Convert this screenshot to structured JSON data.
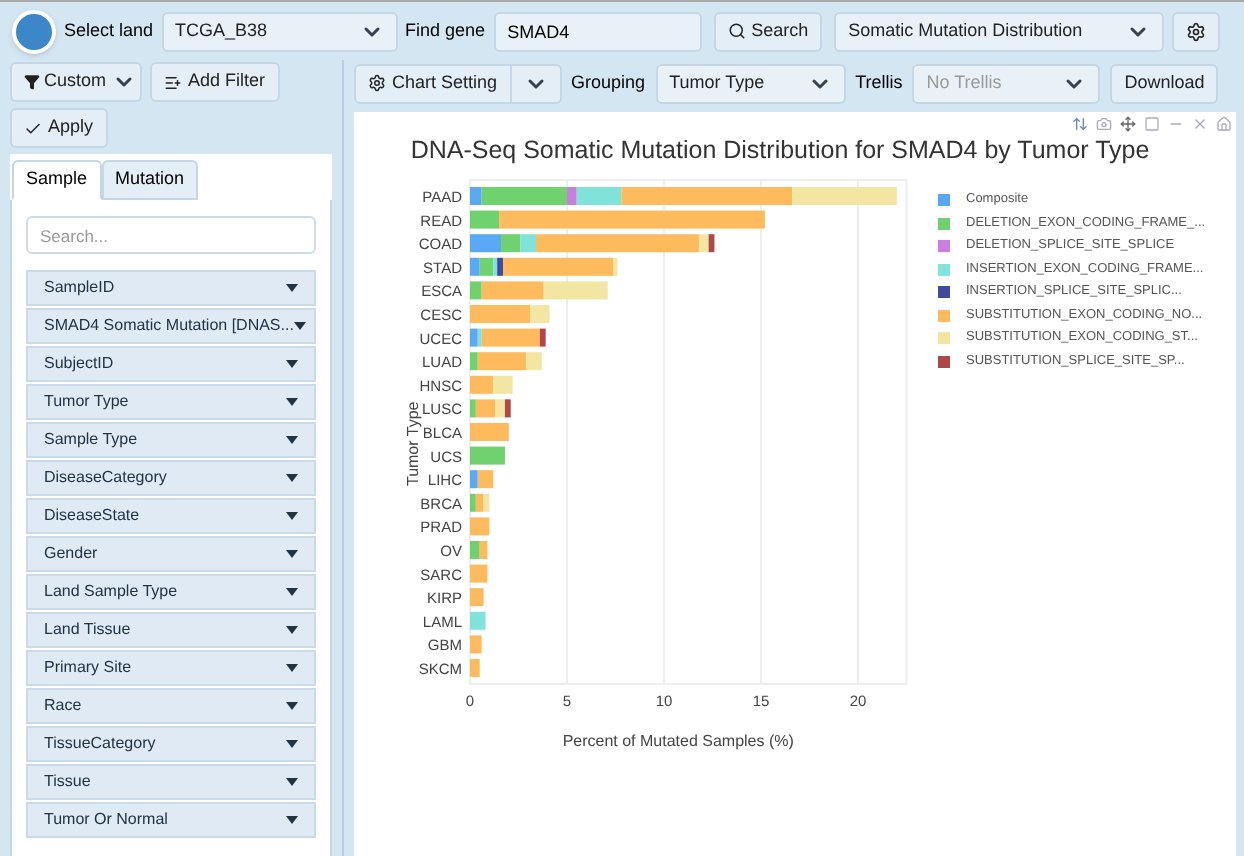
{
  "topbar": {
    "land_label": "Select land",
    "land": "TCGA_B38",
    "gene_label": "Find gene",
    "gene": "SMAD4",
    "search_button": "Search",
    "view": "Somatic Mutation Distribution"
  },
  "filter_toolbar": {
    "custom": "Custom",
    "add_filter": "Add Filter",
    "apply": "Apply"
  },
  "tabs": [
    {
      "label": "Sample",
      "selected": true
    },
    {
      "label": "Mutation",
      "selected": false
    }
  ],
  "search": {
    "placeholder": "Search..."
  },
  "fields": [
    "SampleID",
    "SMAD4 Somatic Mutation [DNAS...",
    "SubjectID",
    "Tumor Type",
    "Sample Type",
    "DiseaseCategory",
    "DiseaseState",
    "Gender",
    "Land Sample Type",
    "Land Tissue",
    "Primary Site",
    "Race",
    "TissueCategory",
    "Tissue",
    "Tumor Or Normal"
  ],
  "chart_toolbar": {
    "chart_setting": "Chart Setting",
    "grouping_label": "Grouping",
    "grouping": "Tumor Type",
    "trellis_label": "Trellis",
    "trellis": "No Trellis",
    "trellis_disabled": true,
    "download": "Download"
  },
  "chart_data": {
    "type": "bar",
    "orientation": "horizontal",
    "stacked": true,
    "grid": true,
    "legend": true,
    "title": "DNA-Seq Somatic Mutation Distribution for SMAD4 by Tumor Type",
    "xlabel": "Percent of Mutated Samples (%)",
    "ylabel": "Tumor Type",
    "xlim": [
      0,
      22.5
    ],
    "xticks": [
      0,
      5,
      10,
      15,
      20
    ],
    "categories": [
      "PAAD",
      "READ",
      "COAD",
      "STAD",
      "ESCA",
      "CESC",
      "UCEC",
      "LUAD",
      "HNSC",
      "LUSC",
      "BLCA",
      "UCS",
      "LIHC",
      "BRCA",
      "PRAD",
      "OV",
      "SARC",
      "KIRP",
      "LAML",
      "GBM",
      "SKCM"
    ],
    "series": [
      {
        "name": "Composite",
        "color": "#5aa9f6",
        "values": [
          0.6,
          0,
          1.6,
          0.5,
          0,
          0,
          0.4,
          0,
          0,
          0,
          0,
          0,
          0.4,
          0,
          0,
          0,
          0,
          0,
          0,
          0,
          0
        ]
      },
      {
        "name": "DELETION_EXON_CODING_FRAME_...",
        "color": "#6fd26f",
        "values": [
          4.4,
          1.5,
          1.0,
          0.7,
          0.6,
          0,
          0,
          0.4,
          0,
          0.3,
          0,
          1.8,
          0,
          0.3,
          0,
          0.5,
          0,
          0,
          0,
          0,
          0
        ]
      },
      {
        "name": "DELETION_SPLICE_SITE_SPLICE",
        "color": "#c97ee0",
        "values": [
          0.5,
          0,
          0,
          0,
          0,
          0,
          0,
          0,
          0,
          0,
          0,
          0,
          0,
          0,
          0,
          0,
          0,
          0,
          0,
          0,
          0
        ]
      },
      {
        "name": "INSERTION_EXON_CODING_FRAME...",
        "color": "#7fe3d9",
        "values": [
          2.3,
          0,
          0.8,
          0.2,
          0,
          0,
          0.2,
          0,
          0,
          0,
          0,
          0,
          0,
          0,
          0,
          0,
          0,
          0,
          0.8,
          0,
          0
        ]
      },
      {
        "name": "INSERTION_SPLICE_SITE_SPLIC...",
        "color": "#3f4aa0",
        "values": [
          0,
          0,
          0,
          0.3,
          0,
          0,
          0,
          0,
          0,
          0,
          0,
          0,
          0,
          0,
          0,
          0,
          0,
          0,
          0,
          0,
          0
        ]
      },
      {
        "name": "SUBSTITUTION_EXON_CODING_NO...",
        "color": "#fdbb5e",
        "values": [
          8.8,
          13.7,
          8.4,
          5.7,
          3.2,
          3.1,
          3.0,
          2.5,
          1.2,
          1.0,
          2.0,
          0,
          0.8,
          0.4,
          1.0,
          0.4,
          0.9,
          0.7,
          0,
          0.6,
          0.5
        ]
      },
      {
        "name": "SUBSTITUTION_EXON_CODING_ST...",
        "color": "#f3e6a3",
        "values": [
          5.4,
          0,
          0.5,
          0.2,
          3.3,
          1.0,
          0,
          0.8,
          1.0,
          0.5,
          0,
          0,
          0,
          0.3,
          0,
          0,
          0,
          0,
          0,
          0,
          0
        ]
      },
      {
        "name": "SUBSTITUTION_SPLICE_SITE_SP...",
        "color": "#b04848",
        "values": [
          0,
          0,
          0.3,
          0,
          0,
          0,
          0.3,
          0,
          0,
          0.3,
          0,
          0,
          0,
          0,
          0,
          0,
          0,
          0,
          0,
          0,
          0
        ]
      }
    ]
  }
}
